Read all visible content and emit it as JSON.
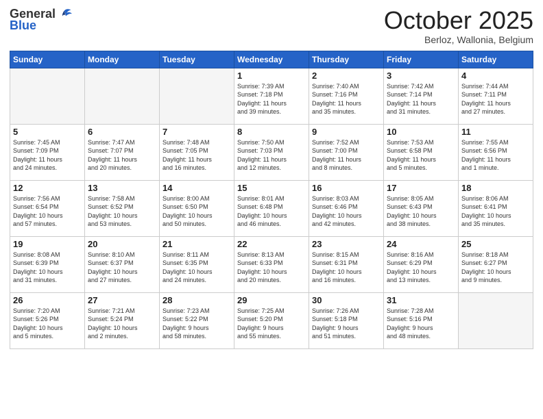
{
  "header": {
    "logo_general": "General",
    "logo_blue": "Blue",
    "month_title": "October 2025",
    "location": "Berloz, Wallonia, Belgium"
  },
  "weekdays": [
    "Sunday",
    "Monday",
    "Tuesday",
    "Wednesday",
    "Thursday",
    "Friday",
    "Saturday"
  ],
  "weeks": [
    [
      {
        "day": "",
        "info": ""
      },
      {
        "day": "",
        "info": ""
      },
      {
        "day": "",
        "info": ""
      },
      {
        "day": "1",
        "info": "Sunrise: 7:39 AM\nSunset: 7:18 PM\nDaylight: 11 hours\nand 39 minutes."
      },
      {
        "day": "2",
        "info": "Sunrise: 7:40 AM\nSunset: 7:16 PM\nDaylight: 11 hours\nand 35 minutes."
      },
      {
        "day": "3",
        "info": "Sunrise: 7:42 AM\nSunset: 7:14 PM\nDaylight: 11 hours\nand 31 minutes."
      },
      {
        "day": "4",
        "info": "Sunrise: 7:44 AM\nSunset: 7:11 PM\nDaylight: 11 hours\nand 27 minutes."
      }
    ],
    [
      {
        "day": "5",
        "info": "Sunrise: 7:45 AM\nSunset: 7:09 PM\nDaylight: 11 hours\nand 24 minutes."
      },
      {
        "day": "6",
        "info": "Sunrise: 7:47 AM\nSunset: 7:07 PM\nDaylight: 11 hours\nand 20 minutes."
      },
      {
        "day": "7",
        "info": "Sunrise: 7:48 AM\nSunset: 7:05 PM\nDaylight: 11 hours\nand 16 minutes."
      },
      {
        "day": "8",
        "info": "Sunrise: 7:50 AM\nSunset: 7:03 PM\nDaylight: 11 hours\nand 12 minutes."
      },
      {
        "day": "9",
        "info": "Sunrise: 7:52 AM\nSunset: 7:00 PM\nDaylight: 11 hours\nand 8 minutes."
      },
      {
        "day": "10",
        "info": "Sunrise: 7:53 AM\nSunset: 6:58 PM\nDaylight: 11 hours\nand 5 minutes."
      },
      {
        "day": "11",
        "info": "Sunrise: 7:55 AM\nSunset: 6:56 PM\nDaylight: 11 hours\nand 1 minute."
      }
    ],
    [
      {
        "day": "12",
        "info": "Sunrise: 7:56 AM\nSunset: 6:54 PM\nDaylight: 10 hours\nand 57 minutes."
      },
      {
        "day": "13",
        "info": "Sunrise: 7:58 AM\nSunset: 6:52 PM\nDaylight: 10 hours\nand 53 minutes."
      },
      {
        "day": "14",
        "info": "Sunrise: 8:00 AM\nSunset: 6:50 PM\nDaylight: 10 hours\nand 50 minutes."
      },
      {
        "day": "15",
        "info": "Sunrise: 8:01 AM\nSunset: 6:48 PM\nDaylight: 10 hours\nand 46 minutes."
      },
      {
        "day": "16",
        "info": "Sunrise: 8:03 AM\nSunset: 6:46 PM\nDaylight: 10 hours\nand 42 minutes."
      },
      {
        "day": "17",
        "info": "Sunrise: 8:05 AM\nSunset: 6:43 PM\nDaylight: 10 hours\nand 38 minutes."
      },
      {
        "day": "18",
        "info": "Sunrise: 8:06 AM\nSunset: 6:41 PM\nDaylight: 10 hours\nand 35 minutes."
      }
    ],
    [
      {
        "day": "19",
        "info": "Sunrise: 8:08 AM\nSunset: 6:39 PM\nDaylight: 10 hours\nand 31 minutes."
      },
      {
        "day": "20",
        "info": "Sunrise: 8:10 AM\nSunset: 6:37 PM\nDaylight: 10 hours\nand 27 minutes."
      },
      {
        "day": "21",
        "info": "Sunrise: 8:11 AM\nSunset: 6:35 PM\nDaylight: 10 hours\nand 24 minutes."
      },
      {
        "day": "22",
        "info": "Sunrise: 8:13 AM\nSunset: 6:33 PM\nDaylight: 10 hours\nand 20 minutes."
      },
      {
        "day": "23",
        "info": "Sunrise: 8:15 AM\nSunset: 6:31 PM\nDaylight: 10 hours\nand 16 minutes."
      },
      {
        "day": "24",
        "info": "Sunrise: 8:16 AM\nSunset: 6:29 PM\nDaylight: 10 hours\nand 13 minutes."
      },
      {
        "day": "25",
        "info": "Sunrise: 8:18 AM\nSunset: 6:27 PM\nDaylight: 10 hours\nand 9 minutes."
      }
    ],
    [
      {
        "day": "26",
        "info": "Sunrise: 7:20 AM\nSunset: 5:26 PM\nDaylight: 10 hours\nand 5 minutes."
      },
      {
        "day": "27",
        "info": "Sunrise: 7:21 AM\nSunset: 5:24 PM\nDaylight: 10 hours\nand 2 minutes."
      },
      {
        "day": "28",
        "info": "Sunrise: 7:23 AM\nSunset: 5:22 PM\nDaylight: 9 hours\nand 58 minutes."
      },
      {
        "day": "29",
        "info": "Sunrise: 7:25 AM\nSunset: 5:20 PM\nDaylight: 9 hours\nand 55 minutes."
      },
      {
        "day": "30",
        "info": "Sunrise: 7:26 AM\nSunset: 5:18 PM\nDaylight: 9 hours\nand 51 minutes."
      },
      {
        "day": "31",
        "info": "Sunrise: 7:28 AM\nSunset: 5:16 PM\nDaylight: 9 hours\nand 48 minutes."
      },
      {
        "day": "",
        "info": ""
      }
    ]
  ]
}
